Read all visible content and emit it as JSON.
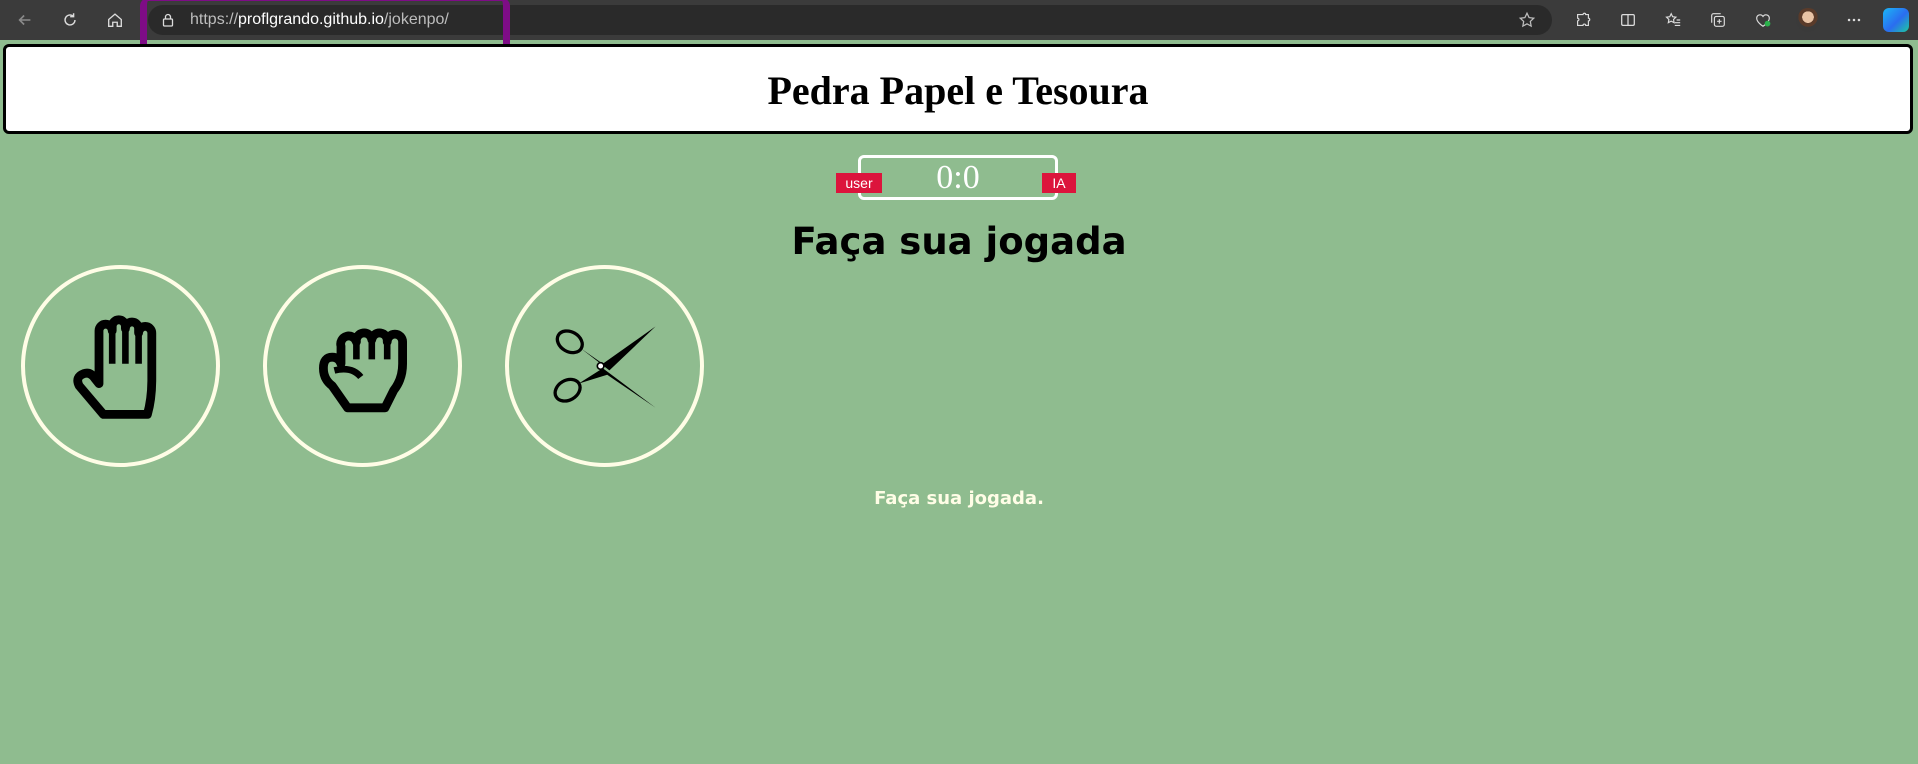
{
  "browser": {
    "url_scheme": "https://",
    "url_host": "proflgrando.github.io",
    "url_path": "/jokenpo/"
  },
  "page": {
    "title": "Pedra Papel e Tesoura",
    "score": "0:0",
    "user_tag": "user",
    "ia_tag": "IA",
    "heading": "Faça sua jogada",
    "message": "Faça sua jogada."
  },
  "choices": [
    {
      "icon": "hand-paper-icon"
    },
    {
      "icon": "hand-rock-icon"
    },
    {
      "icon": "scissors-icon"
    }
  ],
  "colors": {
    "background": "#8fbc8f",
    "highlight": "#7e0c86",
    "tag": "#dc143c",
    "ring": "#fffde6"
  }
}
